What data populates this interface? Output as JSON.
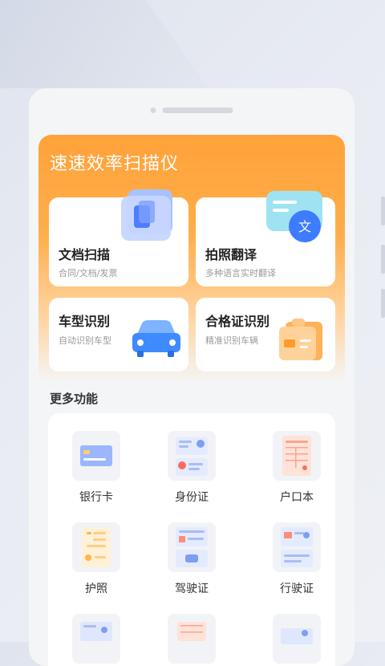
{
  "app_title": "速速效率扫描仪",
  "features": [
    {
      "title": "文档扫描",
      "subtitle": "合同/文档/发票",
      "icon": "document-stack-icon"
    },
    {
      "title": "拍照翻译",
      "subtitle": "多种语言实时翻译",
      "icon": "translate-icon"
    },
    {
      "title": "车型识别",
      "subtitle": "自动识别车型",
      "icon": "car-icon"
    },
    {
      "title": "合格证识别",
      "subtitle": "精准识别车辆",
      "icon": "certificate-icon"
    }
  ],
  "more_section": {
    "title": "更多功能",
    "items": [
      {
        "label": "银行卡",
        "icon": "bank-card-icon"
      },
      {
        "label": "身份证",
        "icon": "id-card-icon"
      },
      {
        "label": "户口本",
        "icon": "household-register-icon"
      },
      {
        "label": "护照",
        "icon": "passport-icon"
      },
      {
        "label": "驾驶证",
        "icon": "driving-license-icon"
      },
      {
        "label": "行驶证",
        "icon": "vehicle-license-icon"
      }
    ]
  },
  "colors": {
    "accent": "#ff9f33",
    "blue": "#4a8dff"
  }
}
